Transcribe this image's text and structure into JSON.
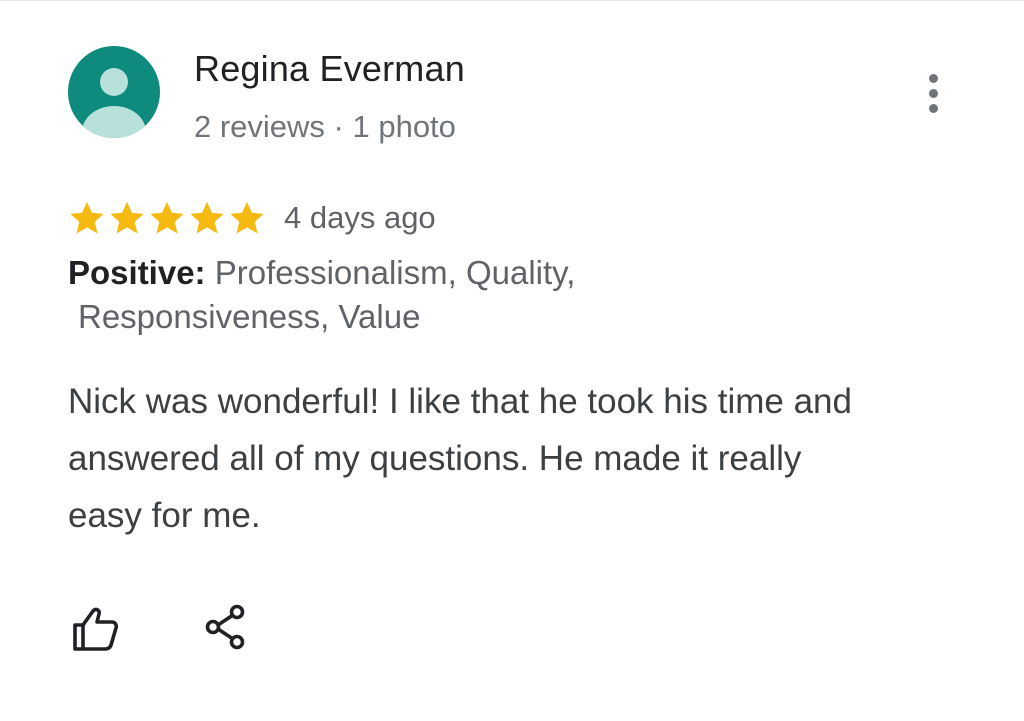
{
  "reviewer": {
    "name": "Regina Everman",
    "meta": "2 reviews · 1 photo",
    "avatar_color": "#0f8b7e"
  },
  "review": {
    "rating": 5,
    "max_rating": 5,
    "star_color": "#f5b90f",
    "date": "4 days ago",
    "highlights_label": "Positive:",
    "highlights_line1": " Professionalism, Quality,",
    "highlights_line2": "Responsiveness, Value",
    "text": "Nick was wonderful! I like that he took his time and answered all of my questions. He made it really easy for me."
  },
  "icons": {
    "more": "more-vert-icon",
    "like": "thumb-up-icon",
    "share": "share-icon"
  }
}
